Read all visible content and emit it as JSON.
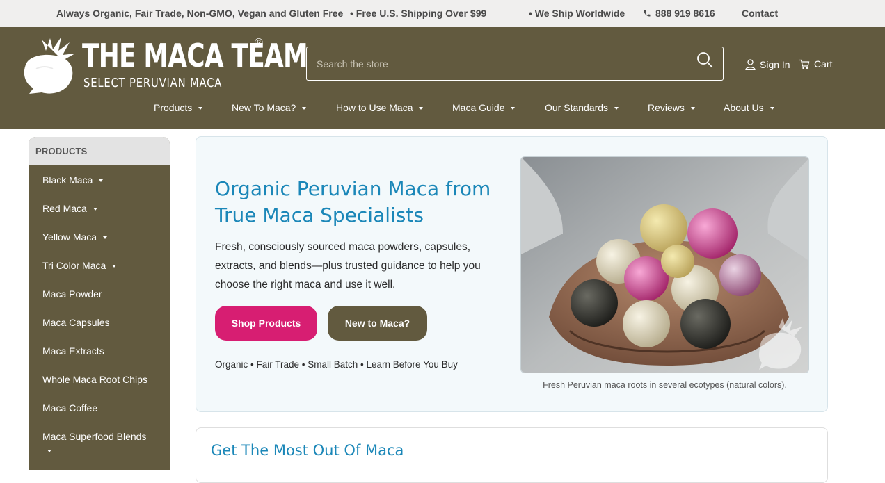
{
  "topbar": {
    "promo": "Always Organic, Fair Trade, Non-GMO, Vegan and Gluten Free",
    "shipping": "• Free U.S. Shipping Over $99",
    "worldwide": "• We Ship Worldwide",
    "phone": "888 919 8616",
    "contact": "Contact"
  },
  "logo": {
    "title": "THE MACA TEAM",
    "registered": "®",
    "subtitle": "SELECT PERUVIAN MACA"
  },
  "search": {
    "placeholder": "Search the store"
  },
  "account": {
    "sign_in": "Sign In",
    "cart": "Cart"
  },
  "nav": {
    "items": [
      {
        "label": "Products"
      },
      {
        "label": "New To Maca?"
      },
      {
        "label": "How to Use Maca"
      },
      {
        "label": "Maca Guide"
      },
      {
        "label": "Our Standards"
      },
      {
        "label": "Reviews"
      },
      {
        "label": "About Us"
      }
    ]
  },
  "sidebar": {
    "heading": "PRODUCTS",
    "items": [
      {
        "label": "Black Maca",
        "has_submenu": true
      },
      {
        "label": "Red Maca",
        "has_submenu": true
      },
      {
        "label": "Yellow Maca",
        "has_submenu": true
      },
      {
        "label": "Tri Color Maca",
        "has_submenu": true
      },
      {
        "label": "Maca Powder",
        "has_submenu": false
      },
      {
        "label": "Maca Capsules",
        "has_submenu": false
      },
      {
        "label": "Maca Extracts",
        "has_submenu": false
      },
      {
        "label": "Whole Maca Root Chips",
        "has_submenu": false
      },
      {
        "label": "Maca Coffee",
        "has_submenu": false
      },
      {
        "label": "Maca Superfood Blends",
        "has_submenu": true
      }
    ]
  },
  "hero": {
    "title": "Organic Peruvian Maca from True Maca Specialists",
    "description": "Fresh, consciously sourced maca powders, capsules, extracts, and blends—plus trusted guidance to help you choose the right maca and use it well.",
    "primary_button": "Shop Products",
    "secondary_button": "New to Maca?",
    "tagline": "Organic • Fair Trade • Small Batch • Learn Before You Buy",
    "image_caption": "Fresh Peruvian maca roots in several ecotypes (natural colors)."
  },
  "section2": {
    "title": "Get The Most Out Of Maca"
  },
  "colors": {
    "brand_olive": "#625a3f",
    "accent_pink": "#d71e72",
    "title_blue": "#1b87b8",
    "topbar_bg": "#f0efee"
  }
}
